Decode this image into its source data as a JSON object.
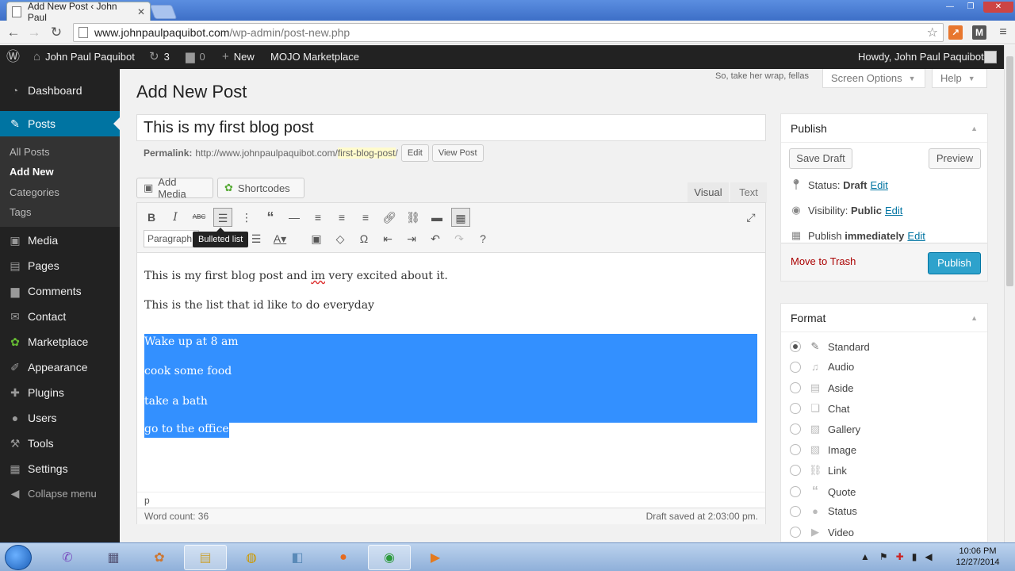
{
  "browser": {
    "tab_title": "Add New Post ‹ John Paul",
    "tab_close": "✕",
    "url_host": "www.johnpaulpaquibot.com",
    "url_path": "/wp-admin/post-new.php"
  },
  "adminbar": {
    "site_name": "John Paul Paquibot",
    "updates_count": "3",
    "comments_count": "0",
    "new_label": "New",
    "mojo_label": "MOJO Marketplace",
    "howdy": "Howdy, John Paul Paquibot"
  },
  "sidebar": {
    "items": [
      {
        "label": "Dashboard",
        "icon": "dashboard-icon"
      },
      {
        "label": "Posts",
        "icon": "pin-icon"
      },
      {
        "label": "Media",
        "icon": "media-icon"
      },
      {
        "label": "Pages",
        "icon": "pages-icon"
      },
      {
        "label": "Comments",
        "icon": "comments-icon"
      },
      {
        "label": "Contact",
        "icon": "mail-icon"
      },
      {
        "label": "Marketplace",
        "icon": "marketplace-icon"
      },
      {
        "label": "Appearance",
        "icon": "brush-icon"
      },
      {
        "label": "Plugins",
        "icon": "plugin-icon"
      },
      {
        "label": "Users",
        "icon": "users-icon"
      },
      {
        "label": "Tools",
        "icon": "wrench-icon"
      },
      {
        "label": "Settings",
        "icon": "settings-icon"
      }
    ],
    "submenu": [
      "All Posts",
      "Add New",
      "Categories",
      "Tags"
    ],
    "collapse": "Collapse menu"
  },
  "header": {
    "title": "Add New Post",
    "hello_dolly": "So, take her wrap, fellas",
    "screen_options": "Screen Options",
    "help": "Help"
  },
  "post": {
    "title": "This is my first blog post",
    "permalink_label": "Permalink:",
    "permalink_base": "http://www.johnpaulpaquibot.com/",
    "permalink_slug": "first-blog-post",
    "permalink_end": "/",
    "edit_btn": "Edit",
    "view_btn": "View Post"
  },
  "editor": {
    "add_media": "Add Media",
    "shortcodes": "Shortcodes",
    "tab_visual": "Visual",
    "tab_text": "Text",
    "format_select": "Paragraph",
    "tooltip": "Bulleted list",
    "content": {
      "p1_before": "This is my first blog post and ",
      "p1_misspelled": "im",
      "p1_after": " very excited about it.",
      "p2": "This is the list that id like to do everyday",
      "list": [
        "Wake up at 8 am",
        "cook some food",
        "take a bath",
        "go to the office"
      ]
    },
    "path": "p",
    "word_count": "Word count: 36",
    "draft_saved": "Draft saved at 2:03:00 pm."
  },
  "publish_box": {
    "title": "Publish",
    "save_draft": "Save Draft",
    "preview": "Preview",
    "status_label": "Status:",
    "status_value": "Draft",
    "visibility_label": "Visibility:",
    "visibility_value": "Public",
    "publish_label": "Publish",
    "publish_value": "immediately",
    "edit_link": "Edit",
    "move_to_trash": "Move to Trash",
    "publish_button": "Publish"
  },
  "format_box": {
    "title": "Format",
    "options": [
      "Standard",
      "Audio",
      "Aside",
      "Chat",
      "Gallery",
      "Image",
      "Link",
      "Quote",
      "Status",
      "Video"
    ],
    "selected": "Standard"
  },
  "taskbar": {
    "time": "10:06 PM",
    "date": "12/27/2014"
  },
  "colors": {
    "admin_dark": "#222222",
    "wp_blue": "#0074a2",
    "publish_blue": "#2ea2cc",
    "selection": "#3390ff"
  }
}
